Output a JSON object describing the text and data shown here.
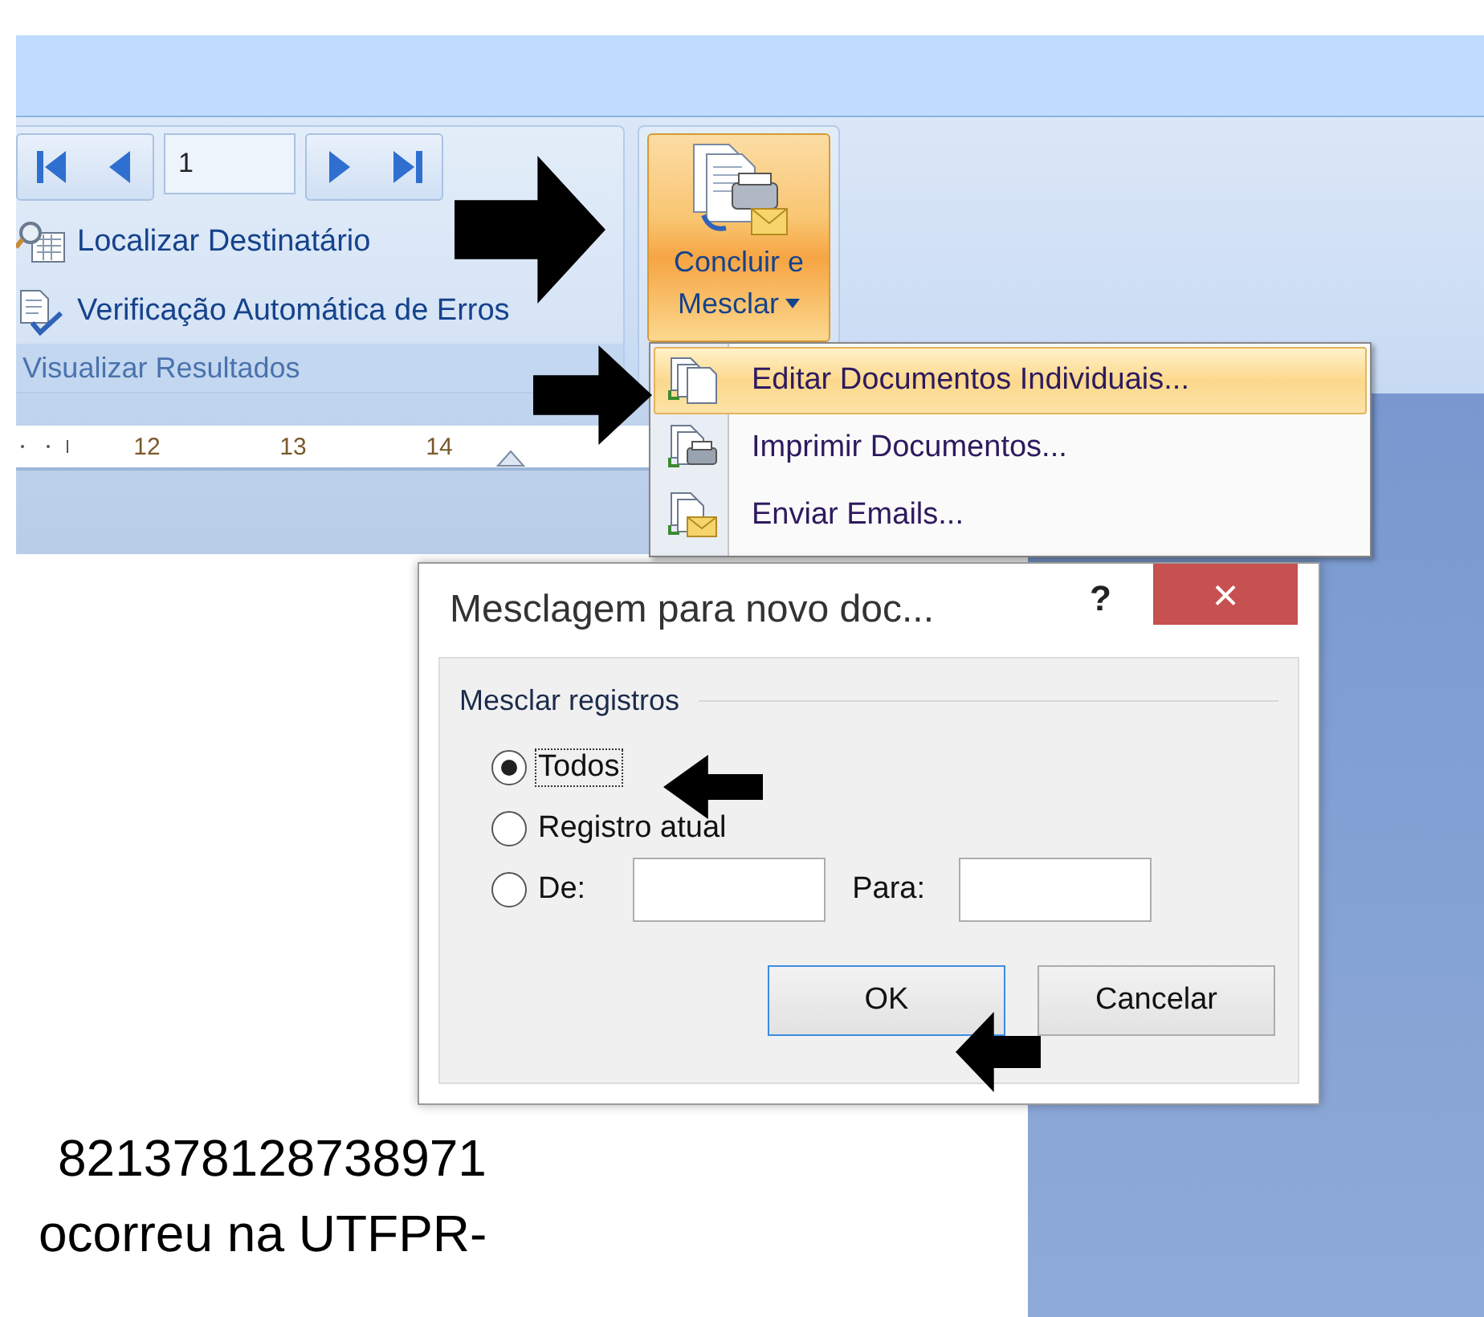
{
  "ribbon": {
    "record": "1",
    "commands": [
      {
        "kind": "find",
        "label": "Localizar Destinatário"
      },
      {
        "kind": "check",
        "label": "Verificação Automática de Erros"
      }
    ],
    "group_label": "Visualizar Resultados",
    "finish_button": {
      "line_1": "Concluir e",
      "line_2": "Mesclar",
      "pressed": true
    }
  },
  "ruler": {
    "numbers": [
      "12",
      "13",
      "14"
    ]
  },
  "menu": {
    "items": [
      {
        "kind": "edit",
        "label": "Editar Documentos Individuais...",
        "selected": true
      },
      {
        "kind": "print",
        "label": "Imprimir Documentos...",
        "selected": false
      },
      {
        "kind": "mail",
        "label": "Enviar Emails...",
        "selected": false
      }
    ]
  },
  "dialog": {
    "title": "Mesclagem para novo doc...",
    "help": "?",
    "close": "×",
    "group": "Mesclar registros",
    "options": [
      {
        "kind": "radio",
        "label": "Todos",
        "selected": true
      },
      {
        "kind": "radio",
        "label": "Registro atual",
        "selected": false
      },
      {
        "kind": "range",
        "label": "De:",
        "to_label": "Para:",
        "selected": false
      }
    ],
    "buttons": [
      {
        "label": "OK",
        "default": true
      },
      {
        "label": "Cancelar",
        "default": false
      }
    ]
  },
  "document": {
    "lines": [
      "821378128738971",
      "ocorreu na UTFPR-"
    ]
  }
}
